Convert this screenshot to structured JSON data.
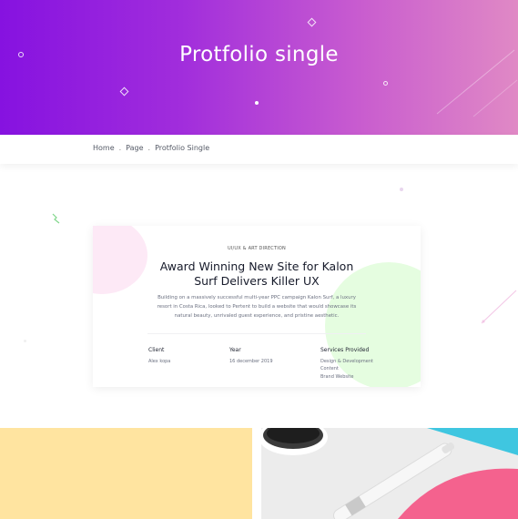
{
  "hero": {
    "title": "Protfolio single"
  },
  "breadcrumb": [
    {
      "label": "Home"
    },
    {
      "label": "Page"
    },
    {
      "label": "Protfolio Single"
    }
  ],
  "breadcrumb_separator": ".",
  "project": {
    "category": "UI/UX & ART DIRECTION",
    "title_line1": "Award Winning New Site for Kalon",
    "title_line2": "Surf Delivers Killer UX",
    "description": "Building on a massively successful multi-year PPC campaign Kalon Surf, a luxury resort in Costa Rica, looked to Pertent to build a website that would showcase its natural beauty, unrivaled guest experience, and pristine aesthetic.",
    "meta": {
      "client_label": "Client",
      "client_value": "Alex kopa",
      "year_label": "Year",
      "year_value": "16 december 2019",
      "services_label": "Services Provided",
      "services": [
        "Design & Development",
        "Content",
        "Brand Website"
      ]
    }
  },
  "colors": {
    "hero_gradient_start": "#8612e0",
    "hero_gradient_end": "#e089c5",
    "tile_yellow": "#ffe4a0",
    "tile_pink": "#f4628e",
    "tile_cyan": "#3fc6e0"
  }
}
